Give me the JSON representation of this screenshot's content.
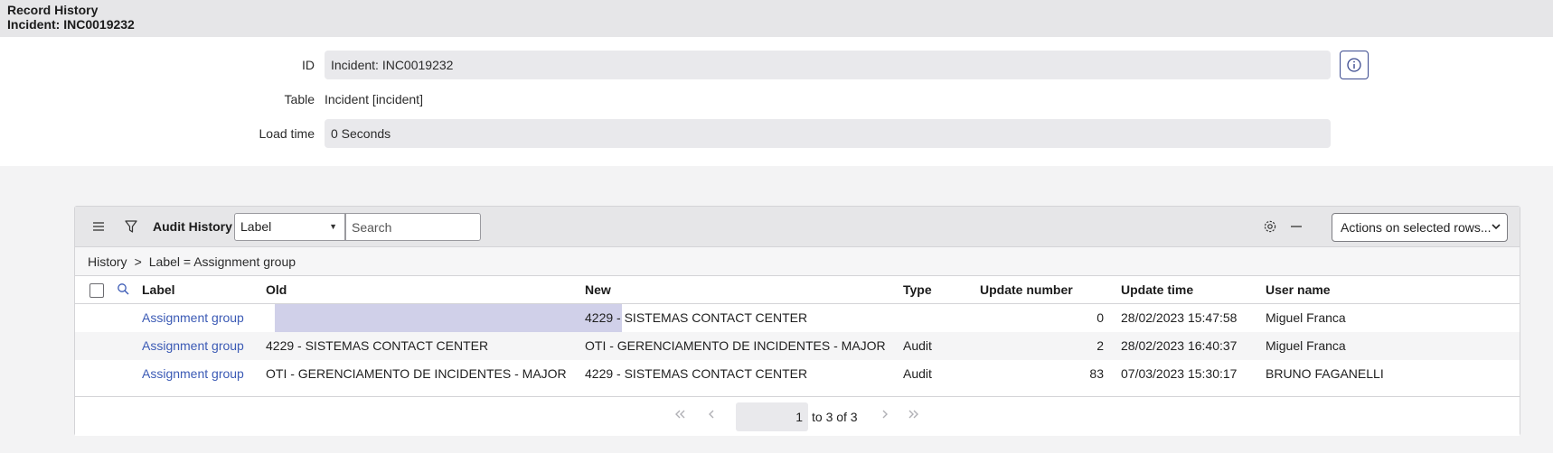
{
  "header": {
    "title": "Record History",
    "subtitle": "Incident: INC0019232"
  },
  "form": {
    "id_label": "ID",
    "id_value": "Incident: INC0019232",
    "table_label": "Table",
    "table_value": "Incident [incident]",
    "loadtime_label": "Load time",
    "loadtime_value": "0 Seconds",
    "info_icon": "info-icon"
  },
  "list": {
    "title": "Audit History",
    "field_select_value": "Label",
    "search_placeholder": "Search",
    "actions_label": "Actions on selected rows...",
    "icons": [
      "hamburger-menu-icon",
      "filter-icon",
      "gear-icon",
      "minus-icon"
    ],
    "breadcrumb": {
      "root": "History",
      "separator": ">",
      "condition": "Label = Assignment group"
    },
    "columns": [
      "Label",
      "Old",
      "New",
      "Type",
      "Update number",
      "Update time",
      "User name"
    ],
    "rows": [
      {
        "label": "Assignment group",
        "old": "",
        "new": "4229 - SISTEMAS CONTACT CENTER",
        "type": "",
        "update_number": "0",
        "update_time": "28/02/2023 15:47:58",
        "user_name": "Miguel Franca"
      },
      {
        "label": "Assignment group",
        "old": "4229 - SISTEMAS CONTACT CENTER",
        "new": "OTI - GERENCIAMENTO DE INCIDENTES - MAJOR",
        "type": "Audit",
        "update_number": "2",
        "update_time": "28/02/2023 16:40:37",
        "user_name": "Miguel Franca"
      },
      {
        "label": "Assignment group",
        "old": "OTI - GERENCIAMENTO DE INCIDENTES - MAJOR",
        "new": "4229 - SISTEMAS CONTACT CENTER",
        "type": "Audit",
        "update_number": "83",
        "update_time": "07/03/2023 15:30:17",
        "user_name": "BRUNO FAGANELLI"
      }
    ],
    "pager": {
      "current": "1",
      "range_text": "to 3 of 3"
    }
  },
  "colors": {
    "link": "#3b5ab5",
    "empty_cell": "#d0d0e9",
    "header_bg": "#e6e6e8"
  }
}
